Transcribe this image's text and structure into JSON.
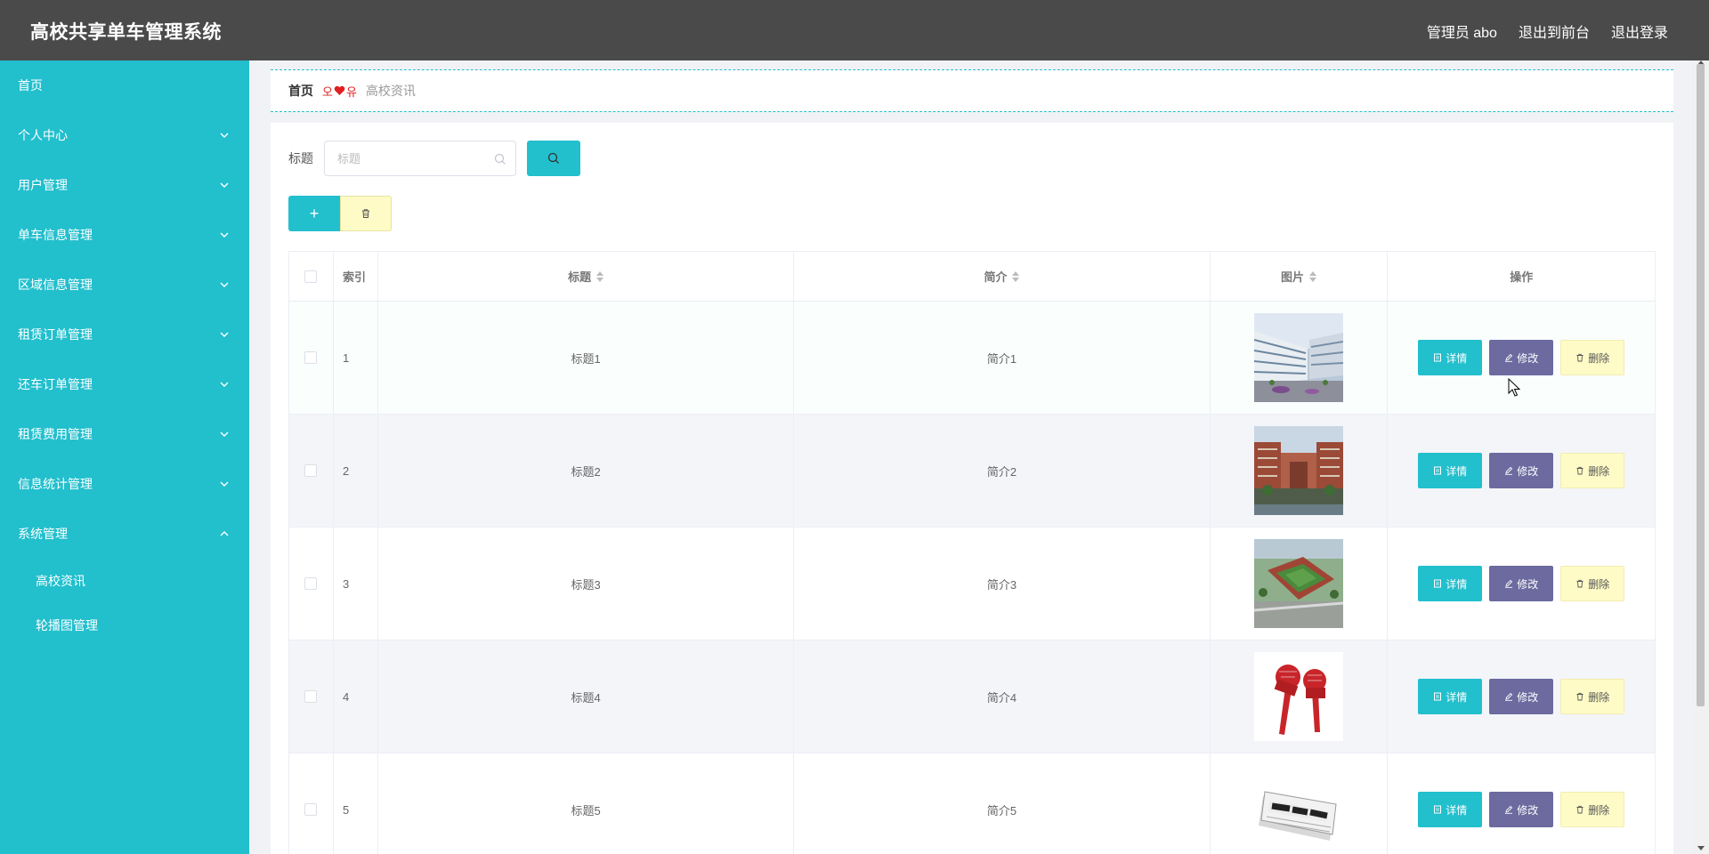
{
  "header": {
    "app_title": "高校共享单车管理系统",
    "user_label": "管理员 abo",
    "to_front": "退出到前台",
    "logout": "退出登录"
  },
  "sidebar": {
    "items": [
      {
        "label": "首页",
        "has_arrow": false
      },
      {
        "label": "个人中心",
        "has_arrow": true
      },
      {
        "label": "用户管理",
        "has_arrow": true
      },
      {
        "label": "单车信息管理",
        "has_arrow": true
      },
      {
        "label": "区域信息管理",
        "has_arrow": true
      },
      {
        "label": "租赁订单管理",
        "has_arrow": true
      },
      {
        "label": "还车订单管理",
        "has_arrow": true
      },
      {
        "label": "租赁费用管理",
        "has_arrow": true
      },
      {
        "label": "信息统计管理",
        "has_arrow": true
      },
      {
        "label": "系统管理",
        "has_arrow": true,
        "expanded": true
      }
    ],
    "submenu": [
      {
        "label": "高校资讯"
      },
      {
        "label": "轮播图管理"
      }
    ]
  },
  "breadcrumb": {
    "home": "首页",
    "sep_left": "오",
    "sep_right": "유",
    "current": "高校资讯"
  },
  "search": {
    "label": "标题",
    "placeholder": "标题",
    "value": ""
  },
  "toolbar": {
    "add_label": "+"
  },
  "table": {
    "headers": {
      "index": "索引",
      "title": "标题",
      "intro": "简介",
      "picture": "图片",
      "actions": "操作"
    },
    "rows": [
      {
        "index": "1",
        "title": "标题1",
        "intro": "简介1",
        "picture": "campus-building-photo"
      },
      {
        "index": "2",
        "title": "标题2",
        "intro": "简介2",
        "picture": "brick-campus-photo"
      },
      {
        "index": "3",
        "title": "标题3",
        "intro": "简介3",
        "picture": "stadium-aerial-photo"
      },
      {
        "index": "4",
        "title": "标题4",
        "intro": "简介4",
        "picture": "news-microphones-image"
      },
      {
        "index": "5",
        "title": "标题5",
        "intro": "简介5",
        "picture": "newspaper-image"
      }
    ],
    "action_labels": {
      "detail": "详情",
      "edit": "修改",
      "delete": "删除"
    }
  },
  "colors": {
    "accent": "#22bfcd",
    "header_bg": "#4a4a4a",
    "edit_btn": "#6c6a9f",
    "delete_btn": "#fffbc6"
  }
}
